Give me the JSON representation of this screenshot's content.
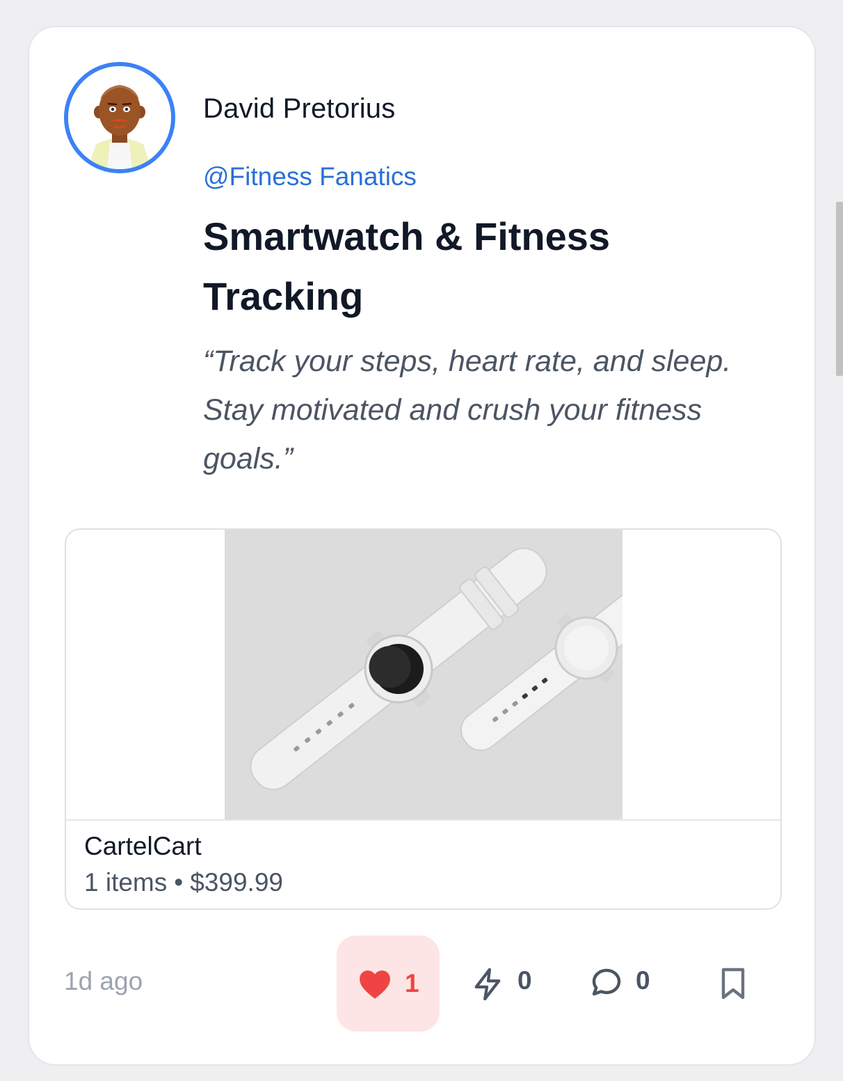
{
  "post": {
    "author_name": "David Pretorius",
    "community": "@Fitness Fanatics",
    "title": "Smartwatch & Fitness Tracking",
    "quote": "“Track your steps, heart rate, and sleep. Stay motivated and crush your fitness goals.”",
    "timestamp": "1d ago"
  },
  "product_card": {
    "store_name": "CartelCart",
    "items": "1 items",
    "separator": "•",
    "price": "$399.99"
  },
  "actions": {
    "like_count": "1",
    "boost_count": "0",
    "comment_count": "0"
  },
  "icons": {
    "like": "heart-icon",
    "boost": "lightning-icon",
    "comment": "comment-icon",
    "save": "bookmark-icon"
  },
  "colors": {
    "avatar_ring": "#3b82f6",
    "community_link": "#2b6fd6",
    "like_active": "#ef4444",
    "like_background": "#fde5e5"
  }
}
